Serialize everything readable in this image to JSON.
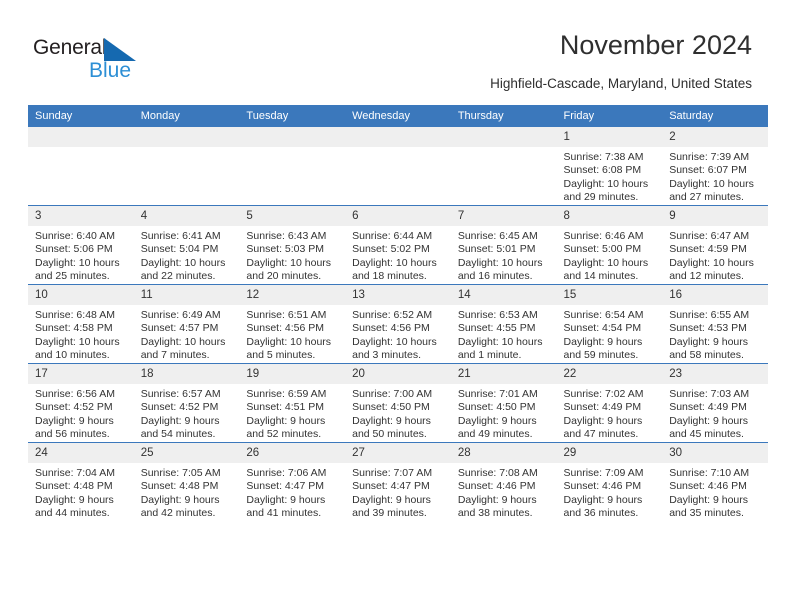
{
  "brand": {
    "name_part1": "General",
    "name_part2": "Blue",
    "triangle_color": "#1569b0",
    "blue_text_color": "#2d8fd5"
  },
  "header": {
    "title": "November 2024",
    "subtitle": "Highfield-Cascade, Maryland, United States",
    "header_bg": "#3b78bc",
    "daynum_bg": "#efefef"
  },
  "weekdays": [
    "Sunday",
    "Monday",
    "Tuesday",
    "Wednesday",
    "Thursday",
    "Friday",
    "Saturday"
  ],
  "labels": {
    "sunrise": "Sunrise:",
    "sunset": "Sunset:",
    "daylight": "Daylight:"
  },
  "weeks": [
    [
      {
        "day": "",
        "empty": true
      },
      {
        "day": "",
        "empty": true
      },
      {
        "day": "",
        "empty": true
      },
      {
        "day": "",
        "empty": true
      },
      {
        "day": "",
        "empty": true
      },
      {
        "day": "1",
        "sunrise": "Sunrise: 7:38 AM",
        "sunset": "Sunset: 6:08 PM",
        "daylight_l1": "Daylight: 10 hours",
        "daylight_l2": "and 29 minutes."
      },
      {
        "day": "2",
        "sunrise": "Sunrise: 7:39 AM",
        "sunset": "Sunset: 6:07 PM",
        "daylight_l1": "Daylight: 10 hours",
        "daylight_l2": "and 27 minutes."
      }
    ],
    [
      {
        "day": "3",
        "sunrise": "Sunrise: 6:40 AM",
        "sunset": "Sunset: 5:06 PM",
        "daylight_l1": "Daylight: 10 hours",
        "daylight_l2": "and 25 minutes."
      },
      {
        "day": "4",
        "sunrise": "Sunrise: 6:41 AM",
        "sunset": "Sunset: 5:04 PM",
        "daylight_l1": "Daylight: 10 hours",
        "daylight_l2": "and 22 minutes."
      },
      {
        "day": "5",
        "sunrise": "Sunrise: 6:43 AM",
        "sunset": "Sunset: 5:03 PM",
        "daylight_l1": "Daylight: 10 hours",
        "daylight_l2": "and 20 minutes."
      },
      {
        "day": "6",
        "sunrise": "Sunrise: 6:44 AM",
        "sunset": "Sunset: 5:02 PM",
        "daylight_l1": "Daylight: 10 hours",
        "daylight_l2": "and 18 minutes."
      },
      {
        "day": "7",
        "sunrise": "Sunrise: 6:45 AM",
        "sunset": "Sunset: 5:01 PM",
        "daylight_l1": "Daylight: 10 hours",
        "daylight_l2": "and 16 minutes."
      },
      {
        "day": "8",
        "sunrise": "Sunrise: 6:46 AM",
        "sunset": "Sunset: 5:00 PM",
        "daylight_l1": "Daylight: 10 hours",
        "daylight_l2": "and 14 minutes."
      },
      {
        "day": "9",
        "sunrise": "Sunrise: 6:47 AM",
        "sunset": "Sunset: 4:59 PM",
        "daylight_l1": "Daylight: 10 hours",
        "daylight_l2": "and 12 minutes."
      }
    ],
    [
      {
        "day": "10",
        "sunrise": "Sunrise: 6:48 AM",
        "sunset": "Sunset: 4:58 PM",
        "daylight_l1": "Daylight: 10 hours",
        "daylight_l2": "and 10 minutes."
      },
      {
        "day": "11",
        "sunrise": "Sunrise: 6:49 AM",
        "sunset": "Sunset: 4:57 PM",
        "daylight_l1": "Daylight: 10 hours",
        "daylight_l2": "and 7 minutes."
      },
      {
        "day": "12",
        "sunrise": "Sunrise: 6:51 AM",
        "sunset": "Sunset: 4:56 PM",
        "daylight_l1": "Daylight: 10 hours",
        "daylight_l2": "and 5 minutes."
      },
      {
        "day": "13",
        "sunrise": "Sunrise: 6:52 AM",
        "sunset": "Sunset: 4:56 PM",
        "daylight_l1": "Daylight: 10 hours",
        "daylight_l2": "and 3 minutes."
      },
      {
        "day": "14",
        "sunrise": "Sunrise: 6:53 AM",
        "sunset": "Sunset: 4:55 PM",
        "daylight_l1": "Daylight: 10 hours",
        "daylight_l2": "and 1 minute."
      },
      {
        "day": "15",
        "sunrise": "Sunrise: 6:54 AM",
        "sunset": "Sunset: 4:54 PM",
        "daylight_l1": "Daylight: 9 hours",
        "daylight_l2": "and 59 minutes."
      },
      {
        "day": "16",
        "sunrise": "Sunrise: 6:55 AM",
        "sunset": "Sunset: 4:53 PM",
        "daylight_l1": "Daylight: 9 hours",
        "daylight_l2": "and 58 minutes."
      }
    ],
    [
      {
        "day": "17",
        "sunrise": "Sunrise: 6:56 AM",
        "sunset": "Sunset: 4:52 PM",
        "daylight_l1": "Daylight: 9 hours",
        "daylight_l2": "and 56 minutes."
      },
      {
        "day": "18",
        "sunrise": "Sunrise: 6:57 AM",
        "sunset": "Sunset: 4:52 PM",
        "daylight_l1": "Daylight: 9 hours",
        "daylight_l2": "and 54 minutes."
      },
      {
        "day": "19",
        "sunrise": "Sunrise: 6:59 AM",
        "sunset": "Sunset: 4:51 PM",
        "daylight_l1": "Daylight: 9 hours",
        "daylight_l2": "and 52 minutes."
      },
      {
        "day": "20",
        "sunrise": "Sunrise: 7:00 AM",
        "sunset": "Sunset: 4:50 PM",
        "daylight_l1": "Daylight: 9 hours",
        "daylight_l2": "and 50 minutes."
      },
      {
        "day": "21",
        "sunrise": "Sunrise: 7:01 AM",
        "sunset": "Sunset: 4:50 PM",
        "daylight_l1": "Daylight: 9 hours",
        "daylight_l2": "and 49 minutes."
      },
      {
        "day": "22",
        "sunrise": "Sunrise: 7:02 AM",
        "sunset": "Sunset: 4:49 PM",
        "daylight_l1": "Daylight: 9 hours",
        "daylight_l2": "and 47 minutes."
      },
      {
        "day": "23",
        "sunrise": "Sunrise: 7:03 AM",
        "sunset": "Sunset: 4:49 PM",
        "daylight_l1": "Daylight: 9 hours",
        "daylight_l2": "and 45 minutes."
      }
    ],
    [
      {
        "day": "24",
        "sunrise": "Sunrise: 7:04 AM",
        "sunset": "Sunset: 4:48 PM",
        "daylight_l1": "Daylight: 9 hours",
        "daylight_l2": "and 44 minutes."
      },
      {
        "day": "25",
        "sunrise": "Sunrise: 7:05 AM",
        "sunset": "Sunset: 4:48 PM",
        "daylight_l1": "Daylight: 9 hours",
        "daylight_l2": "and 42 minutes."
      },
      {
        "day": "26",
        "sunrise": "Sunrise: 7:06 AM",
        "sunset": "Sunset: 4:47 PM",
        "daylight_l1": "Daylight: 9 hours",
        "daylight_l2": "and 41 minutes."
      },
      {
        "day": "27",
        "sunrise": "Sunrise: 7:07 AM",
        "sunset": "Sunset: 4:47 PM",
        "daylight_l1": "Daylight: 9 hours",
        "daylight_l2": "and 39 minutes."
      },
      {
        "day": "28",
        "sunrise": "Sunrise: 7:08 AM",
        "sunset": "Sunset: 4:46 PM",
        "daylight_l1": "Daylight: 9 hours",
        "daylight_l2": "and 38 minutes."
      },
      {
        "day": "29",
        "sunrise": "Sunrise: 7:09 AM",
        "sunset": "Sunset: 4:46 PM",
        "daylight_l1": "Daylight: 9 hours",
        "daylight_l2": "and 36 minutes."
      },
      {
        "day": "30",
        "sunrise": "Sunrise: 7:10 AM",
        "sunset": "Sunset: 4:46 PM",
        "daylight_l1": "Daylight: 9 hours",
        "daylight_l2": "and 35 minutes."
      }
    ]
  ]
}
